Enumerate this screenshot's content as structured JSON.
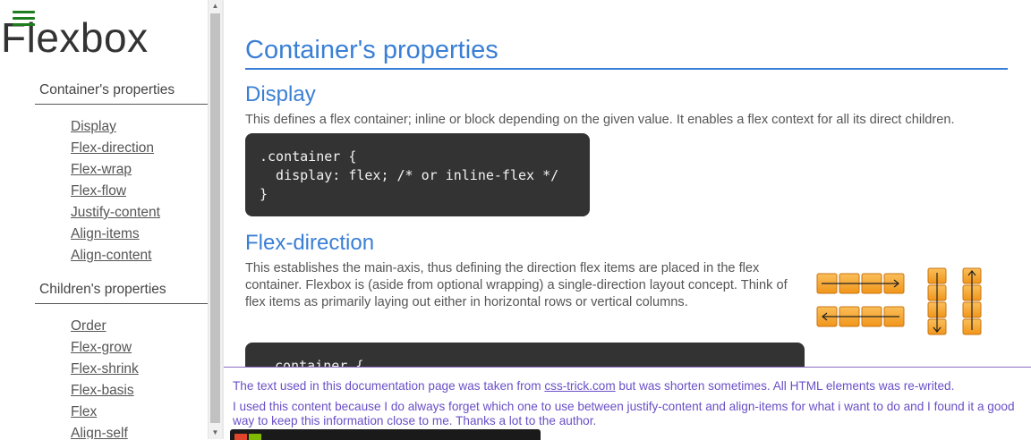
{
  "brand": "Flexbox",
  "sidebar": {
    "container_heading": "Container's properties",
    "container_items": [
      "Display",
      "Flex-direction",
      "Flex-wrap",
      "Flex-flow",
      "Justify-content",
      "Align-items",
      "Align-content"
    ],
    "children_heading": "Children's properties",
    "children_items": [
      "Order",
      "Flex-grow",
      "Flex-shrink",
      "Flex-basis",
      "Flex",
      "Align-self"
    ]
  },
  "main": {
    "title": "Container's properties",
    "display": {
      "title": "Display",
      "text": "This defines a flex container; inline or block depending on the given value. It enables a flex context for all its direct children.",
      "code": ".container {\n  display: flex; /* or inline-flex */\n}"
    },
    "flex_direction": {
      "title": "Flex-direction",
      "text": "This establishes the main-axis, thus defining the direction flex items are placed in the flex container. Flexbox is (aside from optional wrapping) a single-direction layout concept. Think of flex items as primarily laying out either in horizontal rows or vertical columns.",
      "code": ".container {"
    }
  },
  "footer": {
    "line1_before": "The text used in this documentation page was taken from ",
    "line1_link": "css-trick.com",
    "line1_after": " but was shorten sometimes. All HTML elements was re-writed.",
    "line2": "I used this content because I do always forget which one to use between justify-content and align-items for what i want to do and I found it a good way to keep this information close to me. Thanks a lot to the author."
  },
  "colors": {
    "heading_blue": "#3a7fd5",
    "code_bg": "#333333",
    "footer_purple": "#6a4fc7",
    "box_orange": "#f5a623",
    "menu_green": "#1e7d1e"
  }
}
